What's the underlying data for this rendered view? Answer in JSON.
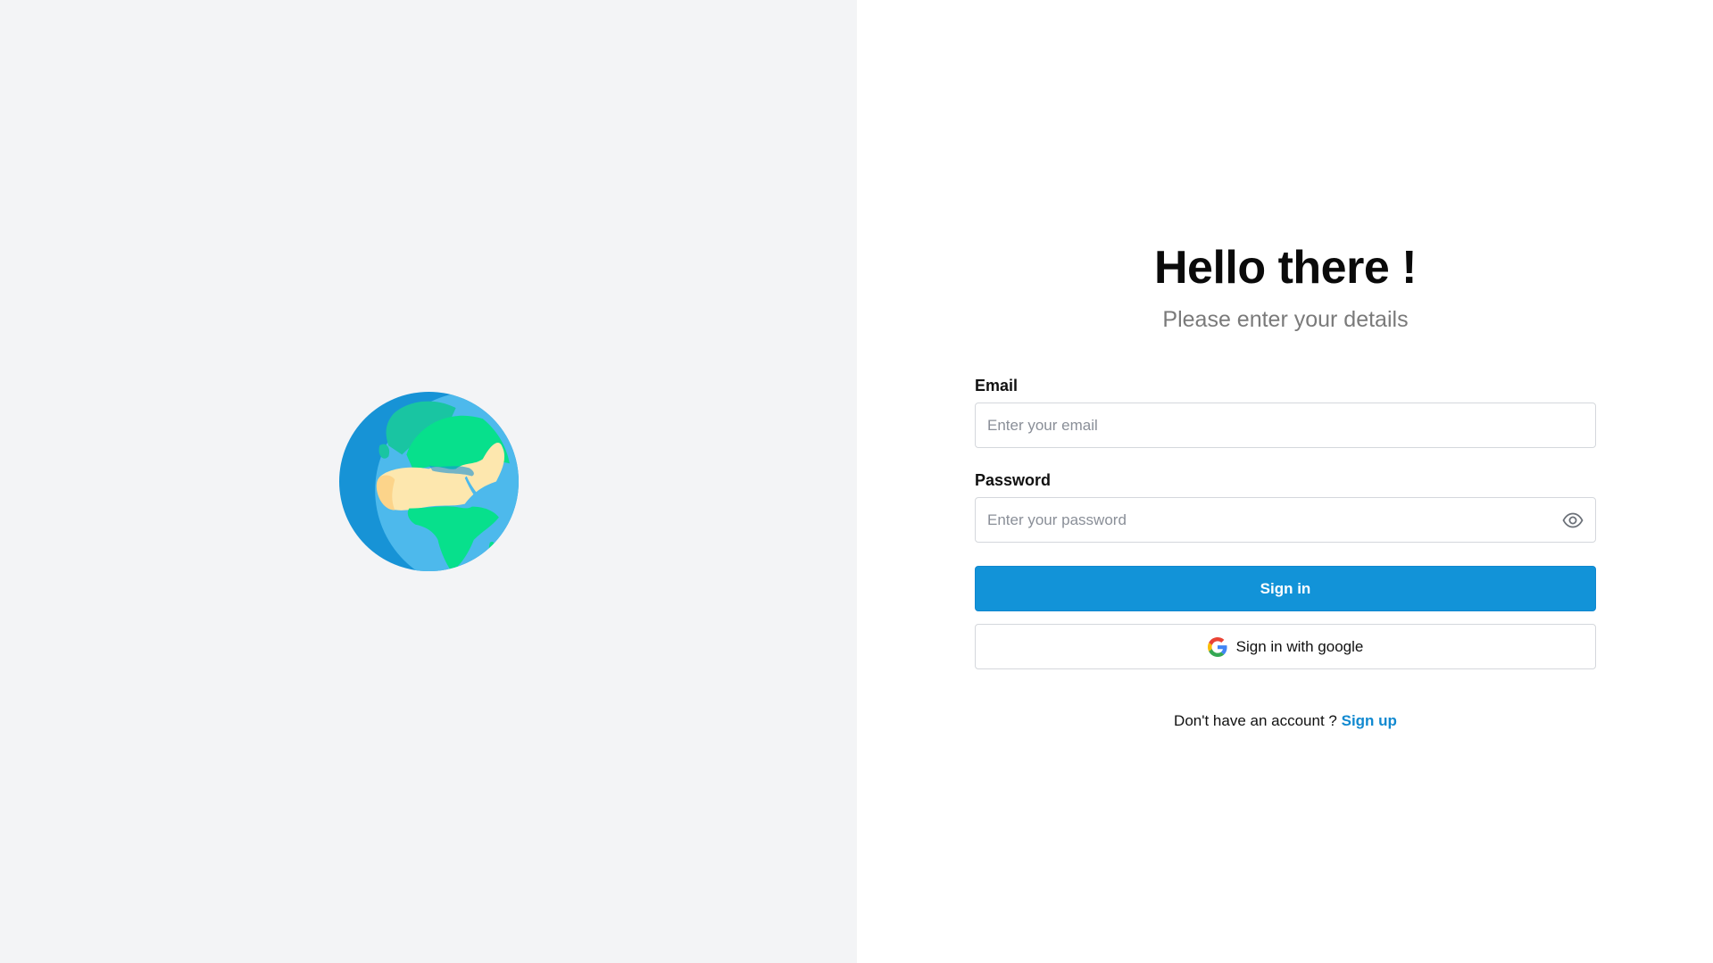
{
  "left": {
    "illustration": "globe-icon"
  },
  "form": {
    "title": "Hello there !",
    "subtitle": "Please enter your details",
    "email": {
      "label": "Email",
      "placeholder": "Enter your email",
      "value": ""
    },
    "password": {
      "label": "Password",
      "placeholder": "Enter your password",
      "value": "",
      "toggle_icon": "eye-icon"
    },
    "sign_in_label": "Sign in",
    "google_label": "Sign in with google",
    "google_icon": "google-icon",
    "signup_prompt": "Don't have an account ?",
    "signup_link": "Sign up"
  },
  "colors": {
    "left_background": "#f3f4f6",
    "primary": "#1293d8",
    "link": "#1189d0"
  }
}
